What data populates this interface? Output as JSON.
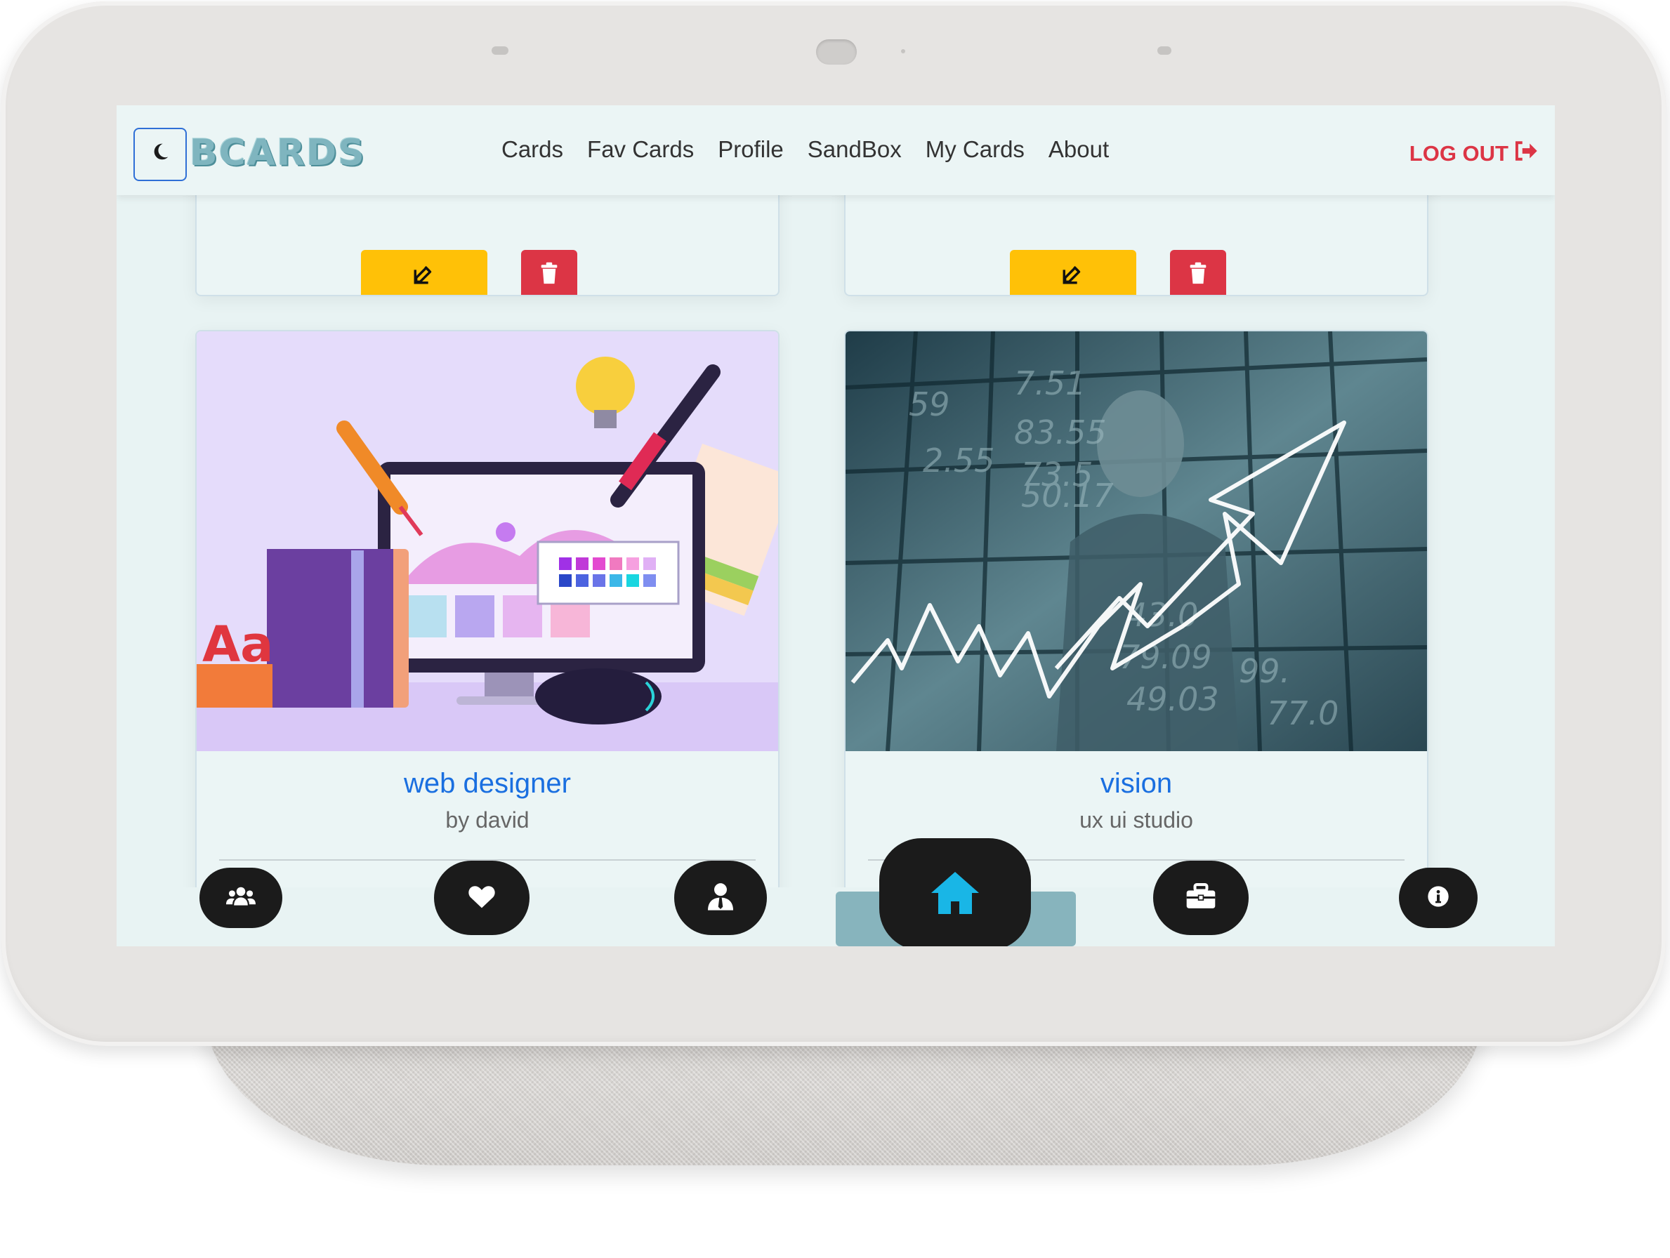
{
  "app": {
    "logo_text": "BCARDS",
    "theme_toggle_icon": "moon-icon"
  },
  "navbar": {
    "links": [
      "Cards",
      "Fav Cards",
      "Profile",
      "SandBox",
      "My Cards",
      "About"
    ],
    "logout_label": "LOG OUT",
    "logout_icon": "sign-out-icon"
  },
  "cards_top": [
    {
      "edit_icon": "edit-icon",
      "delete_icon": "trash-icon"
    },
    {
      "edit_icon": "edit-icon",
      "delete_icon": "trash-icon"
    }
  ],
  "cards": [
    {
      "title": "web designer",
      "subtitle": "by david",
      "image": "web designer illustration"
    },
    {
      "title": "vision",
      "subtitle": "ux ui studio",
      "image": "business growth chart photo"
    }
  ],
  "bottom_nav": {
    "items": [
      {
        "name": "users-icon"
      },
      {
        "name": "heart-icon"
      },
      {
        "name": "user-tie-icon"
      },
      {
        "name": "home-icon",
        "active": true
      },
      {
        "name": "briefcase-icon"
      },
      {
        "name": "info-icon"
      }
    ]
  },
  "colors": {
    "accent_blue": "#1a6fe0",
    "edit_yellow": "#ffc107",
    "delete_red": "#dc3545",
    "home_icon_cyan": "#19b6e6",
    "screen_bg": "#e8f3f3"
  }
}
